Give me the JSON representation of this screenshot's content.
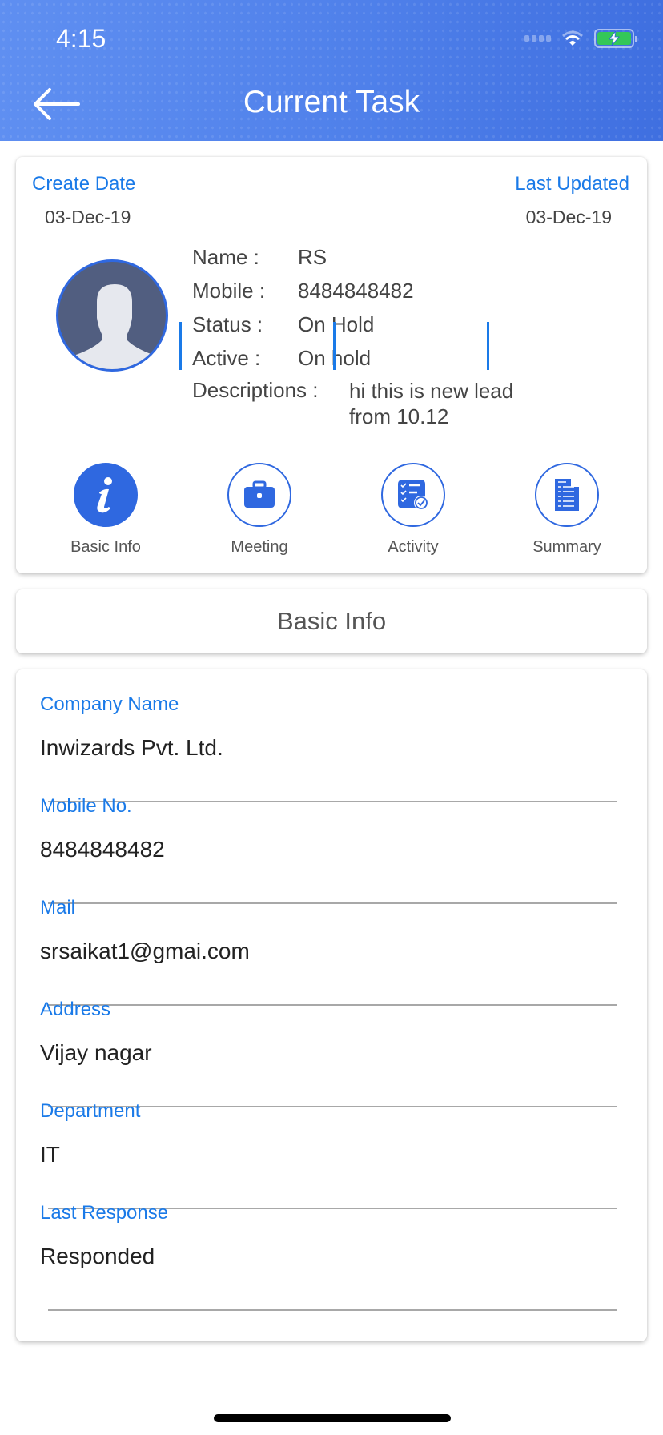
{
  "status_bar": {
    "time": "4:15"
  },
  "header": {
    "title": "Current Task",
    "back_icon": "arrow-left-icon"
  },
  "summary_card": {
    "create_date_label": "Create Date",
    "create_date_value": "03-Dec-19",
    "last_updated_label": "Last Updated",
    "last_updated_value": "03-Dec-19",
    "rows": [
      {
        "key": "Name :",
        "value": "RS"
      },
      {
        "key": "Mobile :",
        "value": "8484848482"
      },
      {
        "key": "Status :",
        "value": "On Hold"
      },
      {
        "key": "Active :",
        "value": "On hold"
      },
      {
        "key": "Descriptions :",
        "value": "hi this is new lead from 10.12"
      }
    ],
    "tabs": [
      {
        "label": "Basic Info",
        "icon": "info-icon",
        "active": true
      },
      {
        "label": "Meeting",
        "icon": "briefcase-icon",
        "active": false
      },
      {
        "label": "Activity",
        "icon": "checklist-icon",
        "active": false
      },
      {
        "label": "Summary",
        "icon": "building-icon",
        "active": false
      }
    ]
  },
  "section_header": {
    "title": "Basic Info"
  },
  "fields": [
    {
      "label": "Company Name",
      "value": "Inwizards Pvt. Ltd."
    },
    {
      "label": "Mobile No.",
      "value": "8484848482"
    },
    {
      "label": "Mail",
      "value": "srsaikat1@gmai.com"
    },
    {
      "label": "Address",
      "value": "Vijay nagar"
    },
    {
      "label": "Department",
      "value": "IT"
    },
    {
      "label": "Last Response",
      "value": "Responded"
    }
  ],
  "colors": {
    "accent": "#1a7ae8",
    "primary": "#2f68e0",
    "header_start": "#5f8ff1",
    "header_end": "#3f6fe0",
    "battery": "#34c759"
  }
}
